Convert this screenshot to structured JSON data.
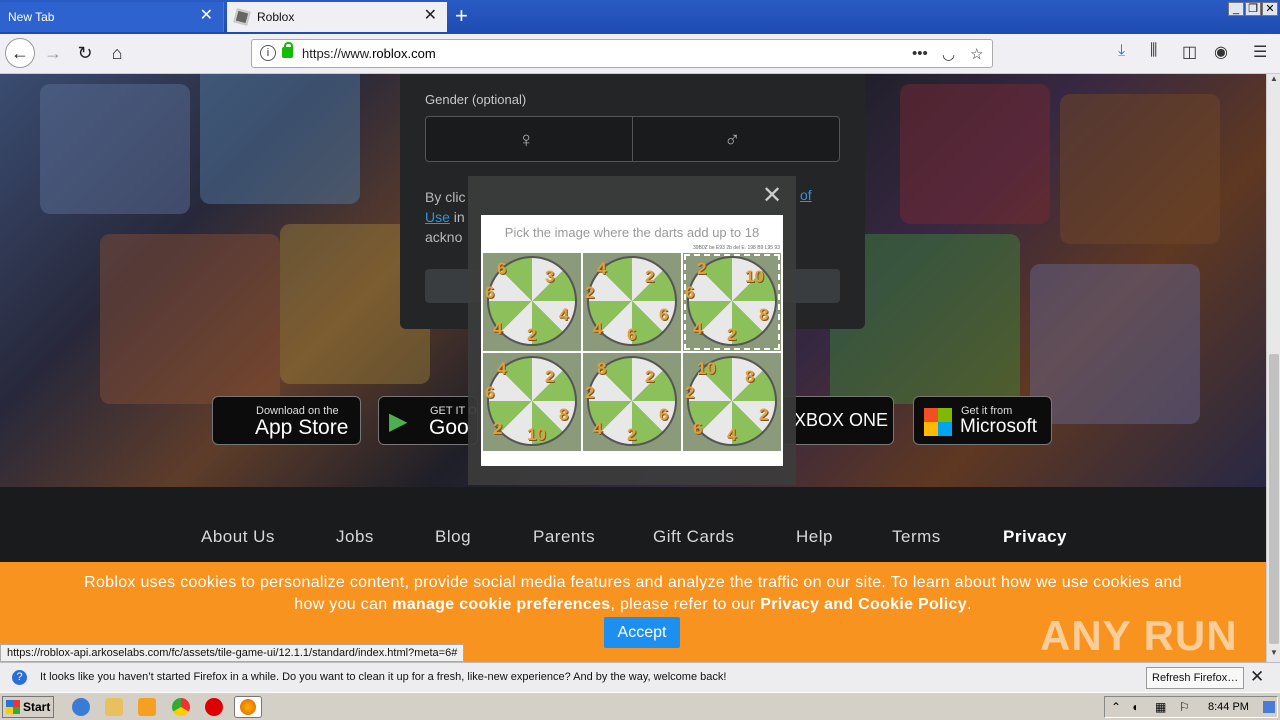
{
  "browser": {
    "tabs": [
      {
        "title": "New Tab",
        "active": false
      },
      {
        "title": "Roblox",
        "active": true
      }
    ],
    "url_prefix": "https://www.",
    "url_host": "roblox.com",
    "status_url": "https://roblox-api.arkoselabs.com/fc/assets/tile-game-ui/12.1.1/standard/index.html?meta=6#"
  },
  "signup": {
    "gender_label": "Gender (optional)",
    "terms_fragment_1": "By clic",
    "terms_fragment_2": "Use",
    "terms_fragment_3": " in",
    "terms_fragment_4": "ackno",
    "terms_link_tail": "of"
  },
  "stores": {
    "apple_small": "Download on the",
    "apple_big": "App Store",
    "google_small": "GET IT O",
    "google_big": "Goo",
    "xbox_big": "XBOX ONE",
    "microsoft_small": "Get it from",
    "microsoft_big": "Microsoft"
  },
  "footer_nav": [
    "About Us",
    "Jobs",
    "Blog",
    "Parents",
    "Gift Cards",
    "Help",
    "Terms",
    "Privacy"
  ],
  "cookie": {
    "line1": "Roblox uses cookies to personalize content, provide social media features and analyze the traffic on our site. To learn about how we use cookies and",
    "line2_pre": "how you can ",
    "link1": "manage cookie preferences",
    "line2_mid": ", please refer to our ",
    "link2": "Privacy and Cookie Policy",
    "line2_post": ".",
    "accept": "Accept"
  },
  "watermark": "ANY RUN",
  "captcha": {
    "prompt": "Pick the image where the darts add up to 18",
    "meta": "39B0Z be E93 2b del E. 198 B9 L95 93",
    "tiles": [
      {
        "numbers": [
          "6",
          "3",
          "6",
          "4",
          "4",
          "2"
        ],
        "selected": false
      },
      {
        "numbers": [
          "4",
          "2",
          "2",
          "6",
          "4",
          "6"
        ],
        "selected": false
      },
      {
        "numbers": [
          "2",
          "10",
          "6",
          "8",
          "4",
          "2"
        ],
        "selected": true
      },
      {
        "numbers": [
          "4",
          "2",
          "6",
          "8",
          "2",
          "10"
        ],
        "selected": false
      },
      {
        "numbers": [
          "8",
          "2",
          "2",
          "6",
          "4",
          "2"
        ],
        "selected": false
      },
      {
        "numbers": [
          "10",
          "8",
          "2",
          "2",
          "6",
          "4"
        ],
        "selected": false
      }
    ]
  },
  "notification": {
    "message": "It looks like you haven’t started Firefox in a while. Do you want to clean it up for a fresh, like-new experience? And by the way, welcome back!",
    "button": "Refresh Firefox…"
  },
  "taskbar": {
    "start": "Start",
    "time": "8:44 PM"
  }
}
